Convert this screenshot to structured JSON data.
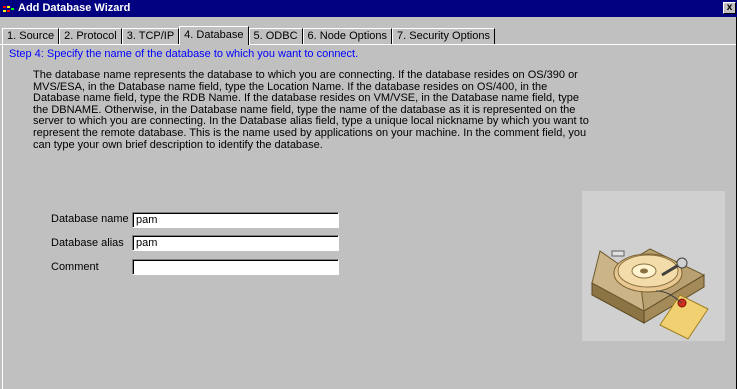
{
  "window": {
    "title": "Add Database Wizard",
    "close_glyph": "x"
  },
  "tabs": [
    {
      "label": "1. Source",
      "active": false
    },
    {
      "label": "2. Protocol",
      "active": false
    },
    {
      "label": "3. TCP/IP",
      "active": false
    },
    {
      "label": "4. Database",
      "active": true
    },
    {
      "label": "5. ODBC",
      "active": false
    },
    {
      "label": "6. Node Options",
      "active": false
    },
    {
      "label": "7. Security Options",
      "active": false
    }
  ],
  "step": {
    "heading": "Step 4: Specify the name of the database to which you want to connect.",
    "description": "The database name represents the database to which you are connecting.   If the database resides on OS/390 or MVS/ESA, in the Database name field, type the Location Name.   If the database resides on OS/400, in the Database name field, type the RDB Name.   If the database resides on VM/VSE, in the Database name field, type the DBNAME.   Otherwise, in the Database name field, type the name of the database as it is represented on the server to which you are connecting.   In the Database alias field, type a unique local nickname by which you want to represent the remote database.   This is the name used by applications on your machine.   In the comment field, you can type your own brief description to identify the database."
  },
  "form": {
    "database_name": {
      "label": "Database name",
      "value": "pam"
    },
    "database_alias": {
      "label": "Database alias",
      "value": "pam"
    },
    "comment": {
      "label": "Comment",
      "value": ""
    }
  },
  "illustration": {
    "icon": "database-hard-drive-with-tag-icon"
  },
  "colors": {
    "titlebar": "#000080",
    "dialog_face": "#c0c0c0",
    "step_heading": "#0000ff"
  }
}
